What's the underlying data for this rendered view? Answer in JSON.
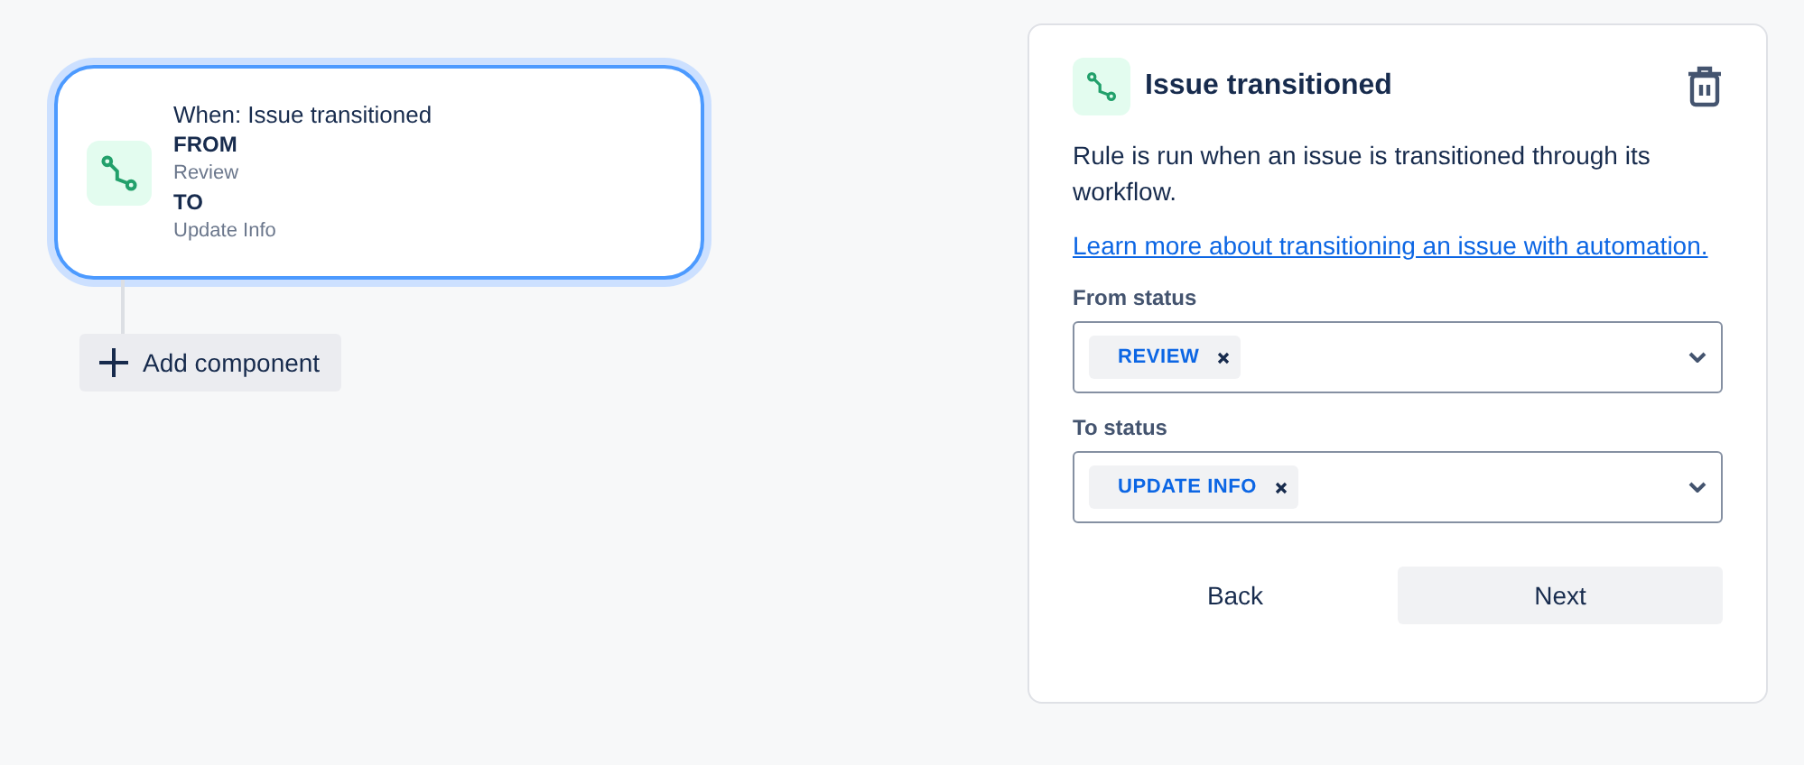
{
  "trigger_card": {
    "selected": true,
    "title": "When: Issue transitioned",
    "lines": [
      {
        "kind": "heading",
        "text": "FROM"
      },
      {
        "kind": "value",
        "text": "Review"
      },
      {
        "kind": "heading",
        "text": "TO"
      },
      {
        "kind": "value",
        "text": "Update Info"
      }
    ]
  },
  "add_component": {
    "label": "Add component"
  },
  "panel": {
    "title": "Issue transitioned",
    "description": "Rule is run when an issue is transitioned through its workflow.",
    "link": "Learn more about transitioning an issue with automation.",
    "fields": [
      {
        "label": "From status",
        "chips": [
          "REVIEW"
        ]
      },
      {
        "label": "To status",
        "chips": [
          "UPDATE INFO"
        ]
      }
    ],
    "buttons": [
      {
        "label": "Back",
        "kind": "subtle"
      },
      {
        "label": "Next",
        "kind": "default"
      }
    ]
  }
}
